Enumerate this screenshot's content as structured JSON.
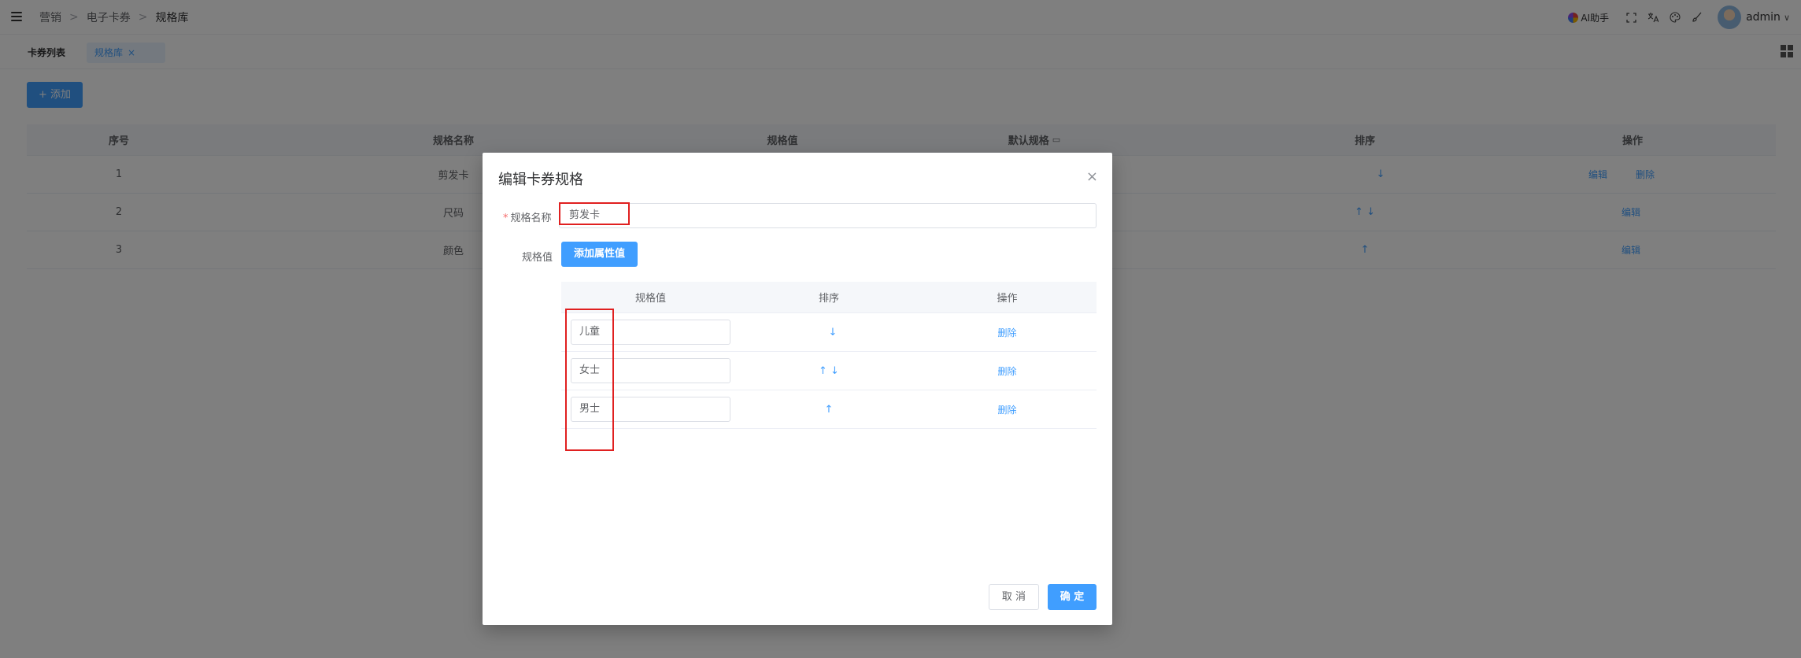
{
  "header": {
    "breadcrumb": [
      "营销",
      "电子卡券",
      "规格库"
    ],
    "breadcrumb_sep": ">",
    "ai_label": "AI助手",
    "user": "admin",
    "icons": [
      "fullscreen-icon",
      "translate-icon",
      "palette-icon",
      "brush-icon"
    ]
  },
  "tabs": [
    {
      "label": "卡券列表"
    },
    {
      "label": "规格库",
      "close": "×"
    }
  ],
  "toolbar": {
    "add_label": "+ 添加"
  },
  "table": {
    "columns": [
      "序号",
      "规格名称",
      "规格值",
      "默认规格",
      "排序",
      "操作"
    ],
    "rows": [
      {
        "index": "1",
        "name": "剪发卡",
        "sort": "↓",
        "actions": [
          "编辑",
          "删除"
        ]
      },
      {
        "index": "2",
        "name": "尺码",
        "sort": "↑ ↓",
        "actions": [
          "编辑"
        ]
      },
      {
        "index": "3",
        "name": "颜色",
        "sort": "↑",
        "actions": [
          "编辑"
        ]
      }
    ]
  },
  "dialog": {
    "title": "编辑卡券规格",
    "close": "×",
    "name_label": "规格名称",
    "required_mark": "*",
    "name_value": "剪发卡",
    "values_label": "规格值",
    "add_attr_label": "添加属性值",
    "columns": [
      "规格值",
      "排序",
      "操作"
    ],
    "rows": [
      {
        "value": "儿童",
        "sort": "↓",
        "action": "删除"
      },
      {
        "value": "女士",
        "sort": "↑ ↓",
        "action": "删除"
      },
      {
        "value": "男士",
        "sort": "↑",
        "action": "删除"
      }
    ],
    "cancel_label": "取 消",
    "ok_label": "确 定"
  },
  "colors": {
    "primary": "#409eff",
    "highlight": "#e02020",
    "danger": "#f56c6c"
  }
}
